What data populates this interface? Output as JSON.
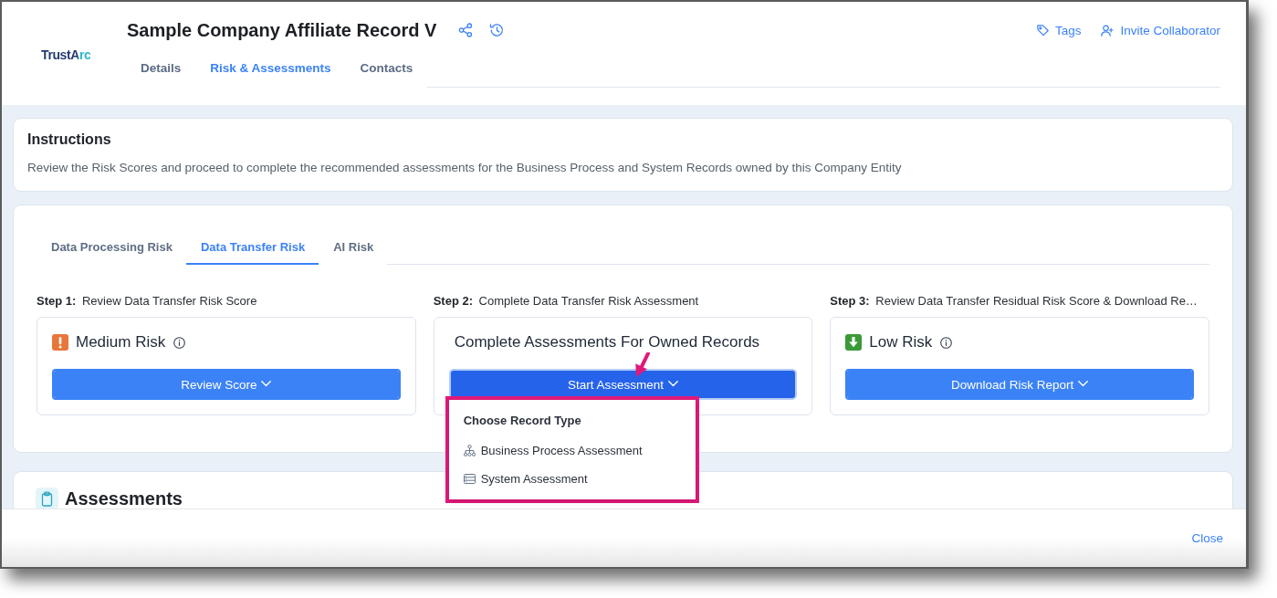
{
  "header": {
    "logo": "TrustArc",
    "title": "Sample Company Affiliate Record V",
    "actions": [
      {
        "kind": "tag",
        "label": "Tags"
      },
      {
        "kind": "invite",
        "label": "Invite Collaborator"
      }
    ],
    "tabs": [
      {
        "label": "Details",
        "selected": false
      },
      {
        "label": "Risk & Assessments",
        "selected": true
      },
      {
        "label": "Contacts",
        "selected": false
      }
    ]
  },
  "instructions": {
    "title": "Instructions",
    "text": "Review the Risk Scores and proceed to complete the recommended assessments for the Business Process and System Records owned by this Company Entity"
  },
  "risk_panel": {
    "tabs": [
      {
        "label": "Data Processing Risk",
        "selected": false
      },
      {
        "label": "Data Transfer Risk",
        "selected": true
      },
      {
        "label": "AI Risk",
        "selected": false
      }
    ],
    "steps": [
      {
        "label": "**Step 1:** Review Data Transfer Risk Score",
        "card": {
          "kind": "medium",
          "title": "Medium Risk",
          "button": {
            "label": "Review Score",
            "expanded": false
          }
        }
      },
      {
        "label": "**Step 2:** Complete Data Transfer Risk Assessment",
        "card": {
          "kind": "plain",
          "title": "Complete Assessments For Owned Records",
          "button": {
            "label": "Start Assessment",
            "expanded": true,
            "menu": {
              "heading": "Choose Record Type",
              "items": [
                {
                  "kind": "process",
                  "label": "Business Process Assessment"
                },
                {
                  "kind": "system",
                  "label": "System Assessment"
                }
              ]
            }
          }
        }
      },
      {
        "label": "**Step 3:** Review Data Transfer Residual Risk Score & Download Re…",
        "card": {
          "kind": "low",
          "title": "Low Risk",
          "button": {
            "label": "Download Risk Report",
            "expanded": false
          }
        }
      }
    ]
  },
  "assessments": {
    "title": "Assessments"
  },
  "footer": {
    "close": "Close"
  }
}
